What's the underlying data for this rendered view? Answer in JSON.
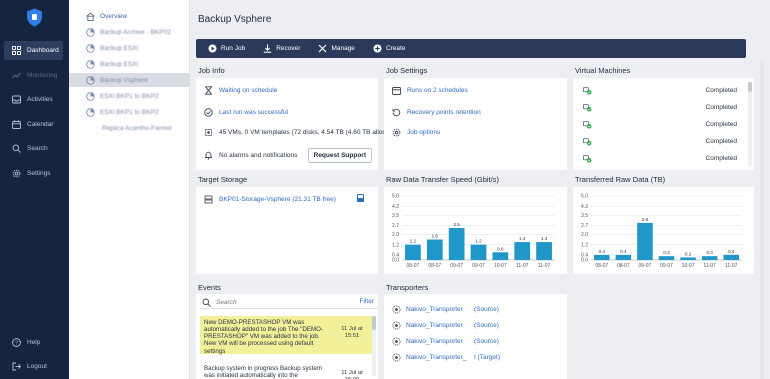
{
  "nav": {
    "items": [
      {
        "label": "Dashboard",
        "icon": "grid-icon"
      },
      {
        "label": "Monitoring",
        "icon": "chart-line-icon"
      },
      {
        "label": "Activities",
        "icon": "inbox-icon"
      },
      {
        "label": "Calendar",
        "icon": "calendar-icon"
      },
      {
        "label": "Search",
        "icon": "search-icon"
      },
      {
        "label": "Settings",
        "icon": "gear-icon"
      }
    ],
    "help": "Help",
    "logout": "Logout"
  },
  "jobs": {
    "overview": "Overview",
    "items": [
      {
        "label": "Backup Archive - BKP02"
      },
      {
        "label": "Backup ESXi"
      },
      {
        "label": "Backup ESXi"
      },
      {
        "label": "Backup Vsphere"
      },
      {
        "label": "ESXi BKP1 to BKP2"
      },
      {
        "label": "ESXi BKP1 to BKP2"
      },
      {
        "label": "Replica Acantho-Farmol"
      }
    ]
  },
  "page": {
    "title": "Backup Vsphere"
  },
  "toolbar": {
    "run": "Run Job",
    "recover": "Recover",
    "manage": "Manage",
    "create": "Create"
  },
  "job_info": {
    "title": "Job Info",
    "rows": [
      "Waiting on schedule",
      "Last run was successful",
      "45 VMs, 0 VM templates (72 disks, 4.54 TB (4.60 TB alloc...",
      "No alarms and notifications"
    ],
    "support": "Request Support"
  },
  "job_settings": {
    "title": "Job Settings",
    "rows": [
      "Runs on 2 schedules",
      "Recovery points retention",
      "Job options"
    ]
  },
  "vms": {
    "title": "Virtual Machines",
    "status": [
      "Completed",
      "Completed",
      "Completed",
      "Completed",
      "Completed"
    ]
  },
  "target_storage": {
    "title": "Target Storage",
    "name": "BKP01-Storage-Vsphere (21.31 TB free)"
  },
  "charts": {
    "raw_speed": {
      "title": "Raw Data Transfer Speed (Gbit/s)"
    },
    "raw_data": {
      "title": "Transferred Raw Data (TB)"
    }
  },
  "chart_data": [
    {
      "type": "bar",
      "title": "Raw Data Transfer Speed (Gbit/s)",
      "categories": [
        "08-07",
        "08-07",
        "09-07",
        "09-07",
        "10-07",
        "11-07",
        "11-07"
      ],
      "values": [
        1.2,
        1.6,
        2.5,
        1.2,
        0.6,
        1.4,
        1.4
      ],
      "yticks": [
        "5.0",
        "4.2",
        "3.5",
        "2.7",
        "2.0",
        "1.2",
        "0.4",
        "0.0"
      ],
      "ylim": [
        0,
        5
      ]
    },
    {
      "type": "bar",
      "title": "Transferred Raw Data (TB)",
      "categories": [
        "08-07",
        "08-07",
        "09-07",
        "09-07",
        "10-07",
        "11-07",
        "11-07"
      ],
      "values": [
        0.4,
        0.4,
        2.9,
        0.3,
        0.2,
        0.3,
        0.4
      ],
      "yticks": [
        "5.0",
        "4.2",
        "3.5",
        "2.7",
        "2.0",
        "1.2",
        "0.4",
        "0.0"
      ],
      "ylim": [
        0,
        5
      ]
    }
  ],
  "events": {
    "title": "Events",
    "search_placeholder": "Search",
    "filter": "Filter",
    "items": [
      {
        "text": "New DEMO-PRESTASHOP VM was automatically added to the job The \"DEMO-PRESTASHOP\" VM was added to the job. New VM will be processed using default settings",
        "date": "11 Jul at 15:51"
      },
      {
        "text": "Backup system in progress Backup system was initiated automatically into the",
        "date": "11 Jul at 15:00"
      }
    ]
  },
  "transporters": {
    "title": "Transporters",
    "items": [
      {
        "name": "Nakivo_Transporter",
        "role": "(Source)"
      },
      {
        "name": "Nakivo_Transporter",
        "role": "(Source)"
      },
      {
        "name": "Nakivo_Transporter",
        "role": "(Source)"
      },
      {
        "name": "Nakivo_Transporter_",
        "role": "I (Target)"
      }
    ]
  }
}
